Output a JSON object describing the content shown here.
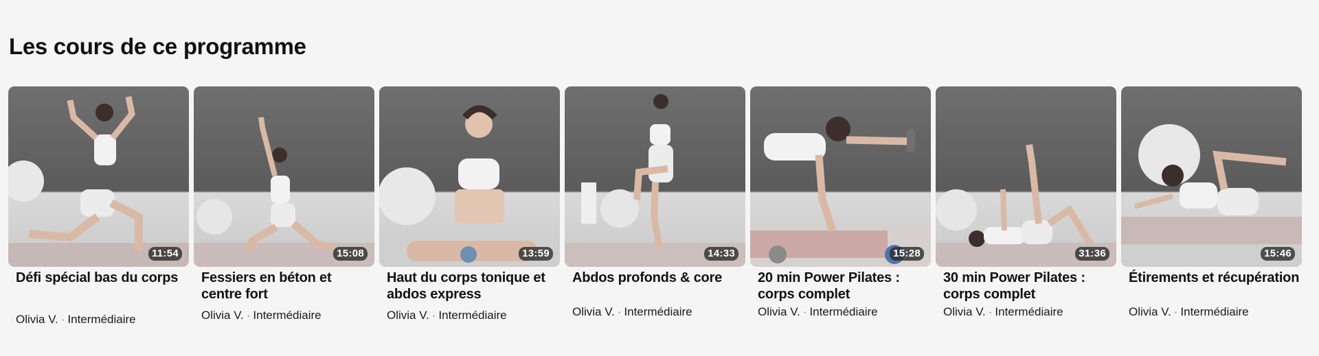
{
  "section": {
    "title": "Les cours de ce programme"
  },
  "courses": [
    {
      "title": "Défi spécial bas du corps",
      "duration": "11:54",
      "instructor": "Olivia V.",
      "separator": "·",
      "level": "Intermédiaire"
    },
    {
      "title": "Fessiers en béton et centre fort",
      "duration": "15:08",
      "instructor": "Olivia V.",
      "separator": "·",
      "level": "Intermédiaire"
    },
    {
      "title": "Haut du corps tonique et abdos express",
      "duration": "13:59",
      "instructor": "Olivia V.",
      "separator": "·",
      "level": "Intermédiaire"
    },
    {
      "title": "Abdos profonds & core",
      "duration": "14:33",
      "instructor": "Olivia V.",
      "separator": "·",
      "level": "Intermédiaire"
    },
    {
      "title": "20 min Power Pilates : corps complet",
      "duration": "15:28",
      "instructor": "Olivia V.",
      "separator": "·",
      "level": "Intermédiaire"
    },
    {
      "title": "30 min Power Pilates : corps complet",
      "duration": "31:36",
      "instructor": "Olivia V.",
      "separator": "·",
      "level": "Intermédiaire"
    },
    {
      "title": "Étirements et récupération",
      "duration": "15:46",
      "instructor": "Olivia V.",
      "separator": "·",
      "level": "Intermédiaire"
    }
  ]
}
